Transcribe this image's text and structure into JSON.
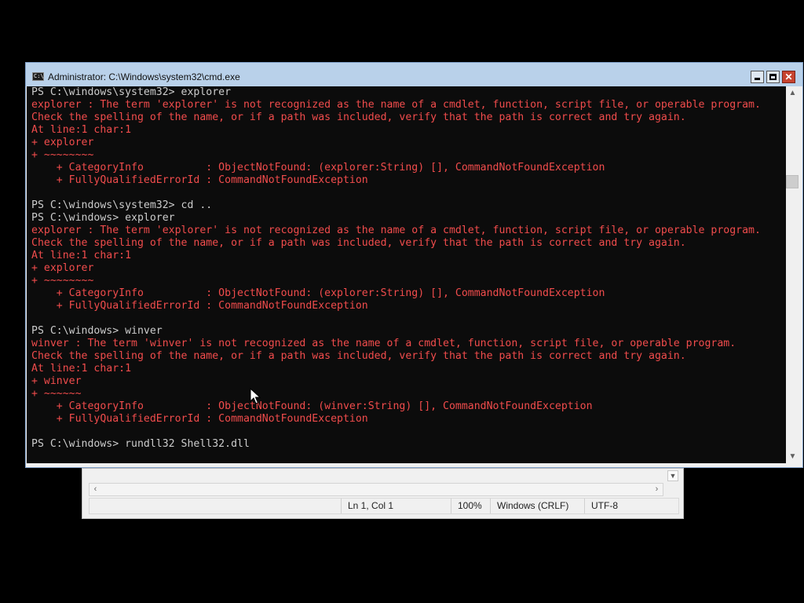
{
  "window": {
    "title": "Administrator: C:\\Windows\\system32\\cmd.exe",
    "icon_text": "C:\\"
  },
  "console": {
    "lines": [
      {
        "text": "PS C:\\windows\\system32> explorer",
        "style": "cmd"
      },
      {
        "text": "explorer : The term 'explorer' is not recognized as the name of a cmdlet, function, script file, or operable program.",
        "style": "err"
      },
      {
        "text": "Check the spelling of the name, or if a path was included, verify that the path is correct and try again.",
        "style": "err"
      },
      {
        "text": "At line:1 char:1",
        "style": "err"
      },
      {
        "text": "+ explorer",
        "style": "err"
      },
      {
        "text": "+ ~~~~~~~~",
        "style": "err"
      },
      {
        "text": "    + CategoryInfo          : ObjectNotFound: (explorer:String) [], CommandNotFoundException",
        "style": "err"
      },
      {
        "text": "    + FullyQualifiedErrorId : CommandNotFoundException",
        "style": "err"
      },
      {
        "text": "",
        "style": "cmd"
      },
      {
        "text": "PS C:\\windows\\system32> cd ..",
        "style": "cmd"
      },
      {
        "text": "PS C:\\windows> explorer",
        "style": "cmd"
      },
      {
        "text": "explorer : The term 'explorer' is not recognized as the name of a cmdlet, function, script file, or operable program.",
        "style": "err"
      },
      {
        "text": "Check the spelling of the name, or if a path was included, verify that the path is correct and try again.",
        "style": "err"
      },
      {
        "text": "At line:1 char:1",
        "style": "err"
      },
      {
        "text": "+ explorer",
        "style": "err"
      },
      {
        "text": "+ ~~~~~~~~",
        "style": "err"
      },
      {
        "text": "    + CategoryInfo          : ObjectNotFound: (explorer:String) [], CommandNotFoundException",
        "style": "err"
      },
      {
        "text": "    + FullyQualifiedErrorId : CommandNotFoundException",
        "style": "err"
      },
      {
        "text": "",
        "style": "cmd"
      },
      {
        "text": "PS C:\\windows> winver",
        "style": "cmd"
      },
      {
        "text": "winver : The term 'winver' is not recognized as the name of a cmdlet, function, script file, or operable program.",
        "style": "err"
      },
      {
        "text": "Check the spelling of the name, or if a path was included, verify that the path is correct and try again.",
        "style": "err"
      },
      {
        "text": "At line:1 char:1",
        "style": "err"
      },
      {
        "text": "+ winver",
        "style": "err"
      },
      {
        "text": "+ ~~~~~~",
        "style": "err"
      },
      {
        "text": "    + CategoryInfo          : ObjectNotFound: (winver:String) [], CommandNotFoundException",
        "style": "err"
      },
      {
        "text": "    + FullyQualifiedErrorId : CommandNotFoundException",
        "style": "err"
      },
      {
        "text": "",
        "style": "cmd"
      },
      {
        "text": "PS C:\\windows> rundll32 Shell32.dll",
        "style": "cmd"
      }
    ]
  },
  "notepad_status": {
    "position": "Ln 1, Col 1",
    "zoom": "100%",
    "line_ending": "Windows (CRLF)",
    "encoding": "UTF-8"
  },
  "colors": {
    "console_bg": "#0c0c0c",
    "command_text": "#cccccc",
    "error_text": "#f14c4c",
    "titlebar": "#b9d1ea"
  }
}
